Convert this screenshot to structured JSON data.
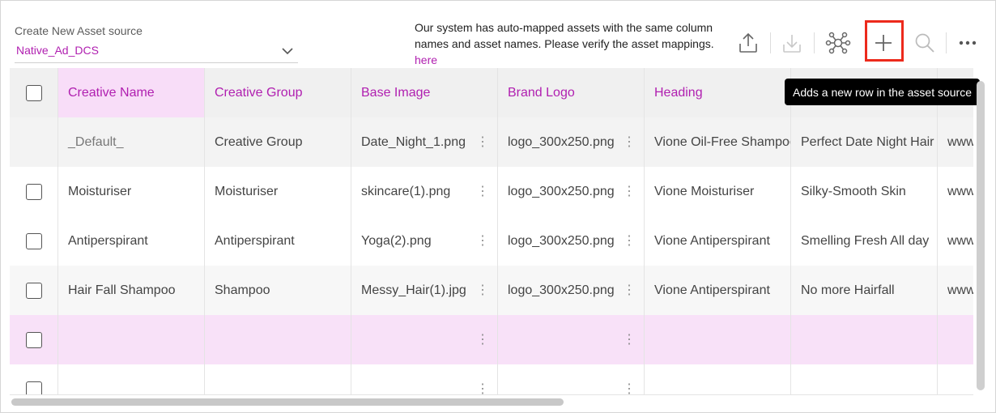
{
  "source": {
    "label": "Create New Asset source",
    "value": "Native_Ad_DCS"
  },
  "info": {
    "text": "Our system has auto-mapped assets with the same column names and asset names. Please verify the asset mappings.",
    "link": "here"
  },
  "toolbar": {
    "icons": [
      "upload-icon",
      "download-icon",
      "network-icon",
      "plus-icon",
      "search-icon",
      "more-icon"
    ],
    "highlight_color": "#ec2a1c"
  },
  "tooltip": "Adds a new row in the asset source",
  "table": {
    "columns": [
      "Creative Name",
      "Creative Group",
      "Base Image",
      "Brand Logo",
      "Heading",
      "",
      ""
    ],
    "rows": [
      [
        "_Default_",
        "Creative Group",
        "Date_Night_1.png",
        "logo_300x250.png",
        "Vione Oil-Free Shampoo",
        "Perfect Date Night Hair",
        "www"
      ],
      [
        "Moisturiser",
        "Moisturiser",
        "skincare(1).png",
        "logo_300x250.png",
        "Vione Moisturiser",
        "Silky-Smooth Skin",
        "www"
      ],
      [
        "Antiperspirant",
        "Antiperspirant",
        "Yoga(2).png",
        "logo_300x250.png",
        "Vione Antiperspirant",
        "Smelling Fresh All day",
        "www"
      ],
      [
        "Hair Fall Shampoo",
        "Shampoo",
        "Messy_Hair(1).jpg",
        "logo_300x250.png",
        "Vione Antiperspirant",
        "No more Hairfall",
        "www"
      ],
      [
        "",
        "",
        "",
        "",
        "",
        "",
        ""
      ],
      [
        "",
        "",
        "",
        "",
        "",
        "",
        ""
      ]
    ]
  },
  "colors": {
    "accent": "#b01fb0",
    "selected_row": "#f8e1f8"
  }
}
